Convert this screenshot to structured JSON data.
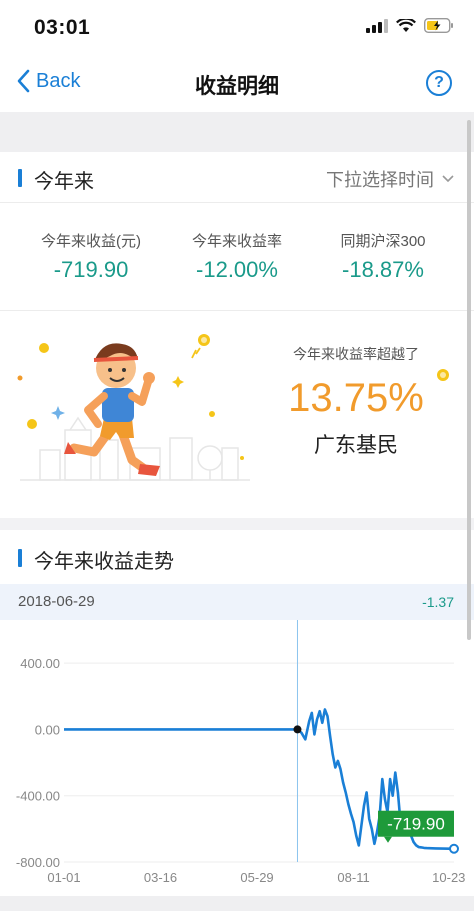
{
  "status_bar": {
    "time": "03:01"
  },
  "nav": {
    "back_label": "Back",
    "title": "收益明细",
    "help_symbol": "?"
  },
  "summary": {
    "section_title": "今年来",
    "period_select": "下拉选择时间",
    "stats": [
      {
        "label": "今年来收益(元)",
        "value": "-719.90"
      },
      {
        "label": "今年来收益率",
        "value": "-12.00%"
      },
      {
        "label": "同期沪深300",
        "value": "-18.87%"
      }
    ]
  },
  "beat": {
    "caption": "今年来收益率超越了",
    "percent": "13.75%",
    "name": "广东基民"
  },
  "trend": {
    "section_title": "今年来收益走势",
    "selected_date": "2018-06-29",
    "selected_value": "-1.37",
    "latest_tooltip": "-719.90"
  },
  "colors": {
    "accent": "#1a7fd6",
    "positive_text": "#1a9a8a",
    "highlight": "#f19b2c",
    "tooltip_bg": "#1e9a3a"
  },
  "chart_data": {
    "type": "line",
    "y_tick_labels": [
      "400.00",
      "0.00",
      "-400.00",
      "-800.00"
    ],
    "y_ticks": [
      400,
      0,
      -400,
      -800
    ],
    "ylim": [
      -800,
      600
    ],
    "x_tick_labels": [
      "01-01",
      "03-16",
      "05-29",
      "08-11",
      "10-23"
    ],
    "x_ticks": [
      0,
      74,
      148,
      222,
      295
    ],
    "xlim": [
      0,
      299
    ],
    "selected_x": 179,
    "series": [
      {
        "x": [
          0,
          40,
          80,
          120,
          160,
          179,
          182,
          185,
          188,
          190,
          192,
          194,
          196,
          198,
          200,
          202,
          204,
          206,
          208,
          210,
          212,
          214,
          216,
          218,
          220,
          222,
          224,
          226,
          228,
          230,
          232,
          234,
          236,
          238,
          240,
          242,
          244,
          246,
          248,
          250,
          252,
          254,
          256,
          258,
          260,
          262,
          264,
          266,
          268,
          270,
          272,
          274,
          276,
          278,
          280,
          285,
          290,
          295,
          299
        ],
        "values": [
          0,
          0,
          0,
          0,
          0,
          0,
          -20,
          -60,
          50,
          100,
          -30,
          60,
          110,
          40,
          120,
          80,
          -40,
          -150,
          -230,
          -190,
          -240,
          -320,
          -380,
          -450,
          -510,
          -560,
          -640,
          -700,
          -580,
          -460,
          -380,
          -540,
          -600,
          -690,
          -620,
          -520,
          -300,
          -420,
          -500,
          -300,
          -400,
          -260,
          -380,
          -560,
          -600,
          -620,
          -580,
          -640,
          -680,
          -700,
          -710,
          -712,
          -715,
          -716,
          -717,
          -718,
          -719,
          -719.5,
          -719.9
        ]
      }
    ]
  }
}
